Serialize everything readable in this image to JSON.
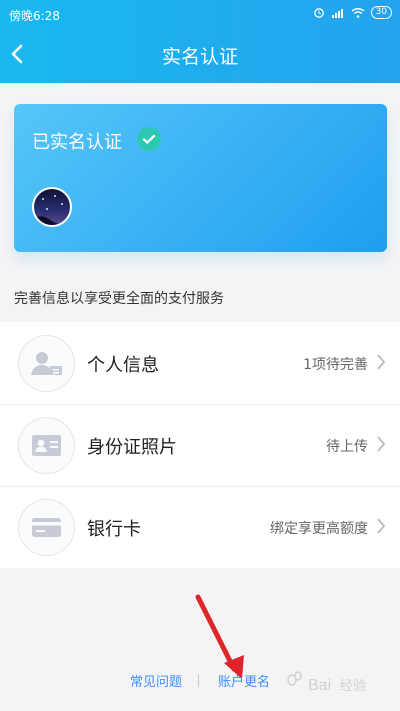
{
  "status_bar": {
    "time": "傍晚6:28",
    "battery": "30"
  },
  "header": {
    "title": "实名认证"
  },
  "card": {
    "title": "已实名认证"
  },
  "section": {
    "hint": "完善信息以享受更全面的支付服务"
  },
  "list": {
    "items": [
      {
        "label": "个人信息",
        "status": "1项待完善"
      },
      {
        "label": "身份证照片",
        "status": "待上传"
      },
      {
        "label": "银行卡",
        "status": "绑定享更高额度"
      }
    ]
  },
  "footer": {
    "faq": "常见问题",
    "account_rename": "账户更名"
  },
  "watermark": {
    "text": "Baidu经验"
  },
  "colors": {
    "header_start": "#19b8f0",
    "header_end": "#24a3ee",
    "link": "#3d8eff",
    "check": "#2cc9b2"
  }
}
